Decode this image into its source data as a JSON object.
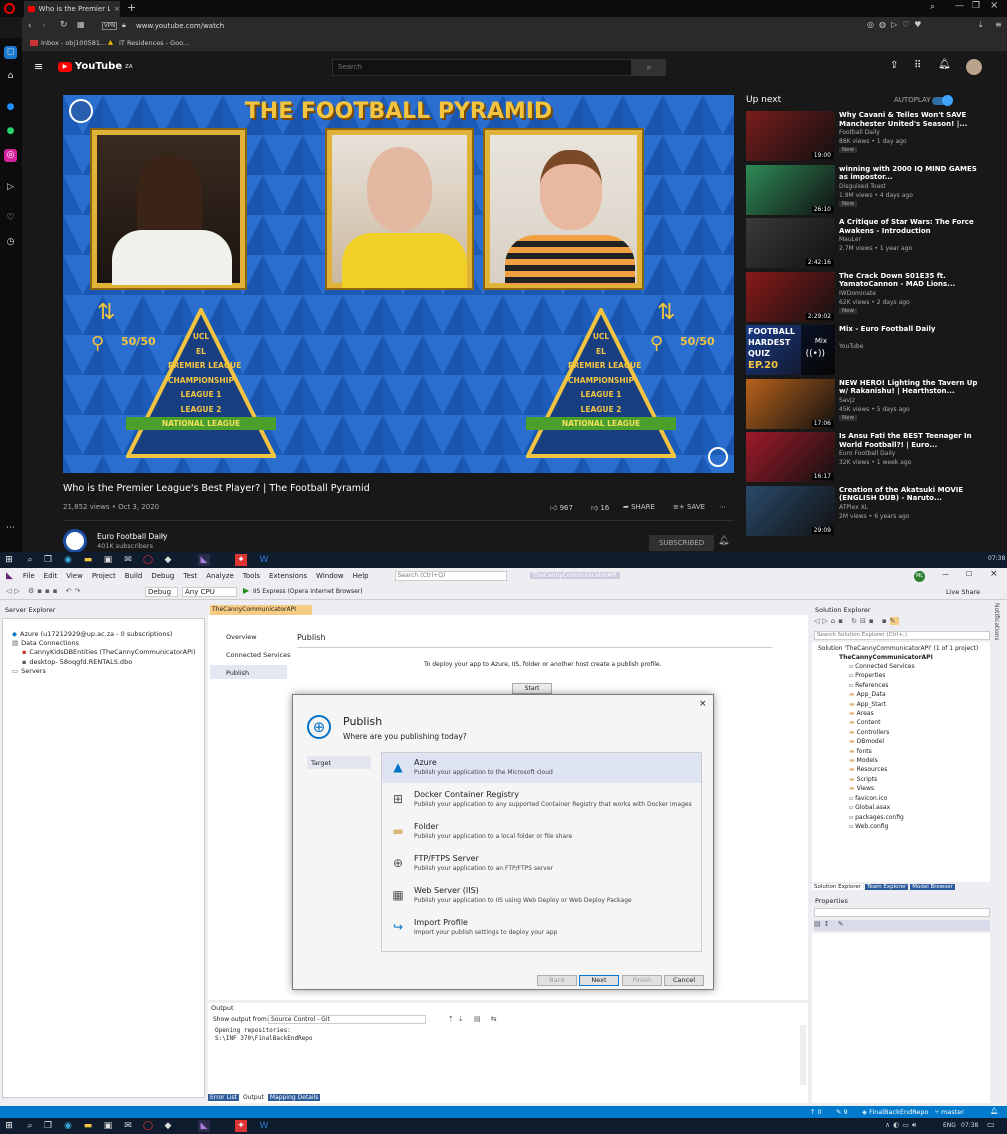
{
  "browser": {
    "tab_title": "Who is the Premier League",
    "url": "www.youtube.com/watch",
    "bookmarks": [
      "Inbox - obj100581...",
      "IT Residences - Goo..."
    ]
  },
  "youtube": {
    "logo": "YouTube",
    "logo_sup": "ZA",
    "search_placeholder": "Search",
    "video_overlay_title": "THE FOOTBALL PYRAMID",
    "pyramid_levels": [
      "UCL",
      "EL",
      "PREMIER LEAGUE",
      "CHAMPIONSHIP",
      "LEAGUE 1",
      "LEAGUE 2",
      "NATIONAL LEAGUE"
    ],
    "fifty_fifty": "50/50",
    "video_title": "Who is the Premier League's Best Player? | The Football Pyramid",
    "views_date": "21,852 views • Oct 3, 2020",
    "likes": "967",
    "dislikes": "16",
    "share": "SHARE",
    "save": "SAVE",
    "channel_name": "Euro Football Daily",
    "subscribers": "401K subscribers",
    "subscribed": "SUBSCRIBED",
    "up_next": "Up next",
    "autoplay": "AUTOPLAY",
    "recommendations": [
      {
        "title": "Why Cavani & Telles Won't SAVE Manchester United's Season! |...",
        "channel": "Football Daily",
        "views": "88K views • 1 day ago",
        "duration": "19:00",
        "badge": "New",
        "color": "#7a1c1c"
      },
      {
        "title": "winning with 2000 IQ MIND GAMES as impostor...",
        "channel": "Disguised Toast",
        "views": "1.9M views • 4 days ago",
        "duration": "26:10",
        "badge": "New",
        "color": "#2e8b57"
      },
      {
        "title": "A Critique of Star Wars: The Force Awakens - Introduction",
        "channel": "MauLer",
        "views": "2.7M views • 1 year ago",
        "duration": "2:42:16",
        "badge": "",
        "color": "#3a3a3a"
      },
      {
        "title": "The Crack Down S01E35 ft. YamatoCannon - MAD Lions...",
        "channel": "IWDominate",
        "views": "62K views • 2 days ago",
        "duration": "2:29:02",
        "badge": "New",
        "color": "#8b1a1a"
      },
      {
        "title": "Mix - Euro Football Daily",
        "channel": "YouTube",
        "views": "",
        "duration": "",
        "badge": "",
        "color": "#1a3a8a"
      },
      {
        "title": "NEW HERO! Lighting the Tavern Up w/ Rakanishu! | Hearthston...",
        "channel": "Savjz",
        "views": "45K views • 5 days ago",
        "duration": "17:06",
        "badge": "New",
        "color": "#b8621a"
      },
      {
        "title": "Is Ansu Fati the BEST Teenager In World Football?! | Euro...",
        "channel": "Euro Football Daily",
        "views": "32K views • 1 week ago",
        "duration": "16:17",
        "badge": "",
        "color": "#a01a2a"
      },
      {
        "title": "Creation of the Akatsuki MOVIE (ENGLISH DUB) - Naruto...",
        "channel": "ATPlex XL",
        "views": "2M views • 6 years ago",
        "duration": "29:09",
        "badge": "",
        "color": "#2a4a6a"
      }
    ],
    "mix_thumb": {
      "line1": "FOOTBALL",
      "line2": "HARDEST",
      "line3": "QUIZ",
      "line4": "EP.20",
      "mix": "Mix"
    }
  },
  "taskbar": {
    "time": "07:38",
    "lang": "ENG"
  },
  "vs": {
    "menu": [
      "File",
      "Edit",
      "View",
      "Project",
      "Build",
      "Debug",
      "Test",
      "Analyze",
      "Tools",
      "Extensions",
      "Window",
      "Help"
    ],
    "search_placeholder": "Search (Ctrl+Q)",
    "project_title": "TheCannyCommunicatorAPI",
    "avatar": "ML",
    "config": "Debug",
    "platform": "Any CPU",
    "run_target": "IIS Express (Opera Internet Browser)",
    "live_share": "Live Share",
    "server_explorer": {
      "title": "Server Explorer",
      "items": [
        "Azure (u17212929@up.ac.za - 0 subscriptions)",
        "Data Connections",
        "CannyKidsDBEntities (TheCannyCommunicatorAPI)",
        "desktop- 58oqgfd.RENTALS.dbo",
        "Servers"
      ]
    },
    "editor_tab": "TheCannyCommunicatorAPI",
    "nav": [
      "Overview",
      "Connected Services",
      "Publish"
    ],
    "publish_heading": "Publish",
    "publish_hint": "To deploy your app to Azure, IIS, folder or another host create a publish profile.",
    "start": "Start",
    "dialog": {
      "title": "Publish",
      "subtitle": "Where are you publishing today?",
      "step": "Target",
      "options": [
        {
          "title": "Azure",
          "desc": "Publish your application to the Microsoft cloud",
          "icon": "azure-icon",
          "glyph": "▲",
          "color": "#0072c6"
        },
        {
          "title": "Docker Container Registry",
          "desc": "Publish your application to any supported Container Registry that works with Docker images",
          "icon": "docker-icon",
          "glyph": "⊞",
          "color": "#555555"
        },
        {
          "title": "Folder",
          "desc": "Publish your application to a local folder or file share",
          "icon": "folder-icon",
          "glyph": "▬",
          "color": "#dcb67a"
        },
        {
          "title": "FTP/FTPS Server",
          "desc": "Publish your application to an FTP/FTPS server",
          "icon": "ftp-icon",
          "glyph": "⊕",
          "color": "#555555"
        },
        {
          "title": "Web Server (IIS)",
          "desc": "Publish your application to IIS using Web Deploy or Web Deploy Package",
          "icon": "iis-icon",
          "glyph": "▦",
          "color": "#555555"
        },
        {
          "title": "Import Profile",
          "desc": "Import your publish settings to deploy your app",
          "icon": "import-icon",
          "glyph": "↪",
          "color": "#0072c6"
        }
      ],
      "buttons": {
        "back": "Back",
        "next": "Next",
        "finish": "Finish",
        "cancel": "Cancel"
      }
    },
    "solution_explorer": {
      "title": "Solution Explorer",
      "search": "Search Solution Explorer (Ctrl+;)",
      "solution": "Solution 'TheCannyCommunicatorAPI' (1 of 1 project)",
      "project": "TheCannyCommunicatorAPI",
      "items": [
        "Connected Services",
        "Properties",
        "References",
        "App_Data",
        "App_Start",
        "Areas",
        "Content",
        "Controllers",
        "DBmodel",
        "fonts",
        "Models",
        "Resources",
        "Scripts",
        "Views",
        "favicon.ico",
        "Global.asax",
        "packages.config",
        "Web.config"
      ],
      "tabs": [
        "Solution Explorer",
        "Team Explorer",
        "Model Browser"
      ]
    },
    "properties": "Properties",
    "output": {
      "title": "Output",
      "show_from_label": "Show output from:",
      "source": "Source Control - Git",
      "lines": [
        "Opening repositories:",
        "S:\\INF 370\\FinalBackEndRepo"
      ],
      "tabs": [
        "Error List",
        "Output",
        "Mapping Details"
      ]
    },
    "notifications": "Notifications",
    "status": {
      "up": "0",
      "edits": "9",
      "repo": "FinalBackEndRepo",
      "branch": "master"
    }
  },
  "colors": {
    "youtube_red": "#ff0000",
    "vs_blue": "#007acc",
    "dark_bg": "#181818"
  }
}
